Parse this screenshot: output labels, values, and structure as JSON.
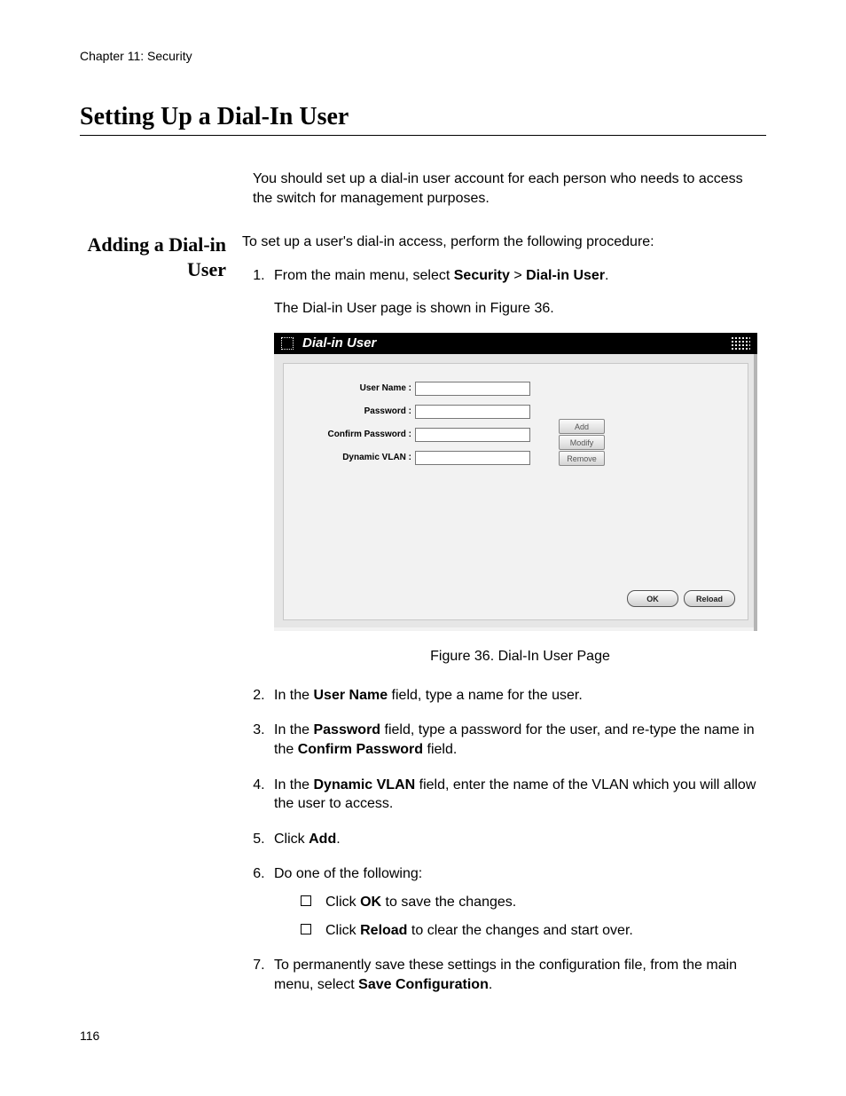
{
  "header": {
    "chapter": "Chapter 11: Security",
    "title": "Setting Up a Dial-In User"
  },
  "intro": "You should set up a dial-in user account for each person who needs to access the switch for management purposes.",
  "section_label": "Adding a Dial-in User",
  "lead_in": "To set up a user's dial-in access, perform the following procedure:",
  "steps": {
    "s1_pre": "From the main menu, select ",
    "s1_b1": "Security",
    "s1_mid": " > ",
    "s1_b2": "Dial-in User",
    "s1_post": ".",
    "s1_note": "The Dial-in User page is shown in Figure 36.",
    "s2_pre": "In the ",
    "s2_b": "User Name",
    "s2_post": " field, type a name for the user.",
    "s3_pre": "In the ",
    "s3_b1": "Password",
    "s3_mid": " field, type a password for the user, and re-type the name in the ",
    "s3_b2": "Confirm Password",
    "s3_post": " field.",
    "s4_pre": "In the ",
    "s4_b": "Dynamic VLAN",
    "s4_post": " field, enter the name of the VLAN which you will allow the user to access.",
    "s5_pre": "Click ",
    "s5_b": "Add",
    "s5_post": ".",
    "s6": "Do one of the following:",
    "s6a_pre": "Click ",
    "s6a_b": "OK",
    "s6a_post": " to save the changes.",
    "s6b_pre": "Click ",
    "s6b_b": "Reload",
    "s6b_post": " to clear the changes and start over.",
    "s7_pre": "To permanently save these settings in the configuration file, from the main menu, select ",
    "s7_b": "Save Configuration",
    "s7_post": "."
  },
  "figure": {
    "title": "Dial-in User",
    "labels": {
      "username": "User Name :",
      "password": "Password :",
      "confirm": "Confirm Password :",
      "vlan": "Dynamic VLAN :"
    },
    "buttons": {
      "add": "Add",
      "modify": "Modify",
      "remove": "Remove",
      "ok": "OK",
      "reload": "Reload"
    },
    "caption": "Figure 36. Dial-In User Page"
  },
  "page_number": "116"
}
